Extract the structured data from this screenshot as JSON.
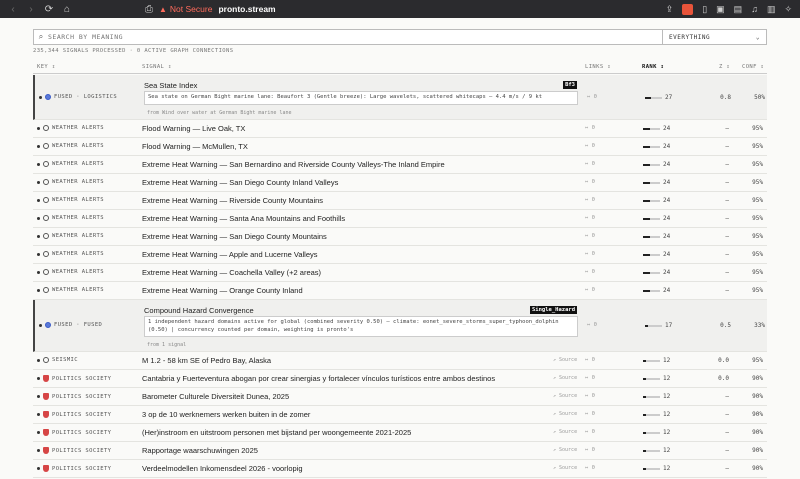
{
  "browser": {
    "security_label": "Not Secure",
    "host": "pronto.stream"
  },
  "search": {
    "placeholder": "SEARCH BY MEANING",
    "scope": "EVERYTHING"
  },
  "status_line": "235,344 SIGNALS PROCESSED · 0 ACTIVE GRAPH CONNECTIONS",
  "columns": {
    "key": "KEY ⇕",
    "signal": "SIGNAL ⇕",
    "links": "LINKS ⇕",
    "rank": "RANK ↕",
    "z": "Z ⇕",
    "conf": "CONF ⇕"
  },
  "rows": [
    {
      "key": "FUSED · LOGISTICS",
      "icon": "ring-blue",
      "title": "Sea State Index",
      "tag": "Bf3",
      "desc": "Sea state on German Bight marine lane: Beaufort 3 (Gentle breeze): Large wavelets, scattered whitecaps — 4.4 m/s / 9 kt",
      "from": "from Wind over water at German Bight marine lane",
      "links": "⇔ 0",
      "rank_fill": 0.35,
      "rank": "27",
      "z": "0.8",
      "conf": "50%",
      "source": ""
    },
    {
      "key": "WEATHER ALERTS",
      "icon": "ring",
      "title": "Flood Warning — Live Oak, TX",
      "links": "⇔ 0",
      "rank_fill": 0.4,
      "rank": "24",
      "z": "—",
      "conf": "95%",
      "source": ""
    },
    {
      "key": "WEATHER ALERTS",
      "icon": "ring",
      "title": "Flood Warning — McMullen, TX",
      "links": "⇔ 0",
      "rank_fill": 0.4,
      "rank": "24",
      "z": "—",
      "conf": "95%",
      "source": ""
    },
    {
      "key": "WEATHER ALERTS",
      "icon": "ring",
      "title": "Extreme Heat Warning — San Bernardino and Riverside County Valleys-The Inland Empire",
      "links": "⇔ 0",
      "rank_fill": 0.4,
      "rank": "24",
      "z": "—",
      "conf": "95%",
      "source": ""
    },
    {
      "key": "WEATHER ALERTS",
      "icon": "ring",
      "title": "Extreme Heat Warning — San Diego County Inland Valleys",
      "links": "⇔ 0",
      "rank_fill": 0.4,
      "rank": "24",
      "z": "—",
      "conf": "95%",
      "source": ""
    },
    {
      "key": "WEATHER ALERTS",
      "icon": "ring",
      "title": "Extreme Heat Warning — Riverside County Mountains",
      "links": "⇔ 0",
      "rank_fill": 0.4,
      "rank": "24",
      "z": "—",
      "conf": "95%",
      "source": ""
    },
    {
      "key": "WEATHER ALERTS",
      "icon": "ring",
      "title": "Extreme Heat Warning — Santa Ana Mountains and Foothills",
      "links": "⇔ 0",
      "rank_fill": 0.4,
      "rank": "24",
      "z": "—",
      "conf": "95%",
      "source": ""
    },
    {
      "key": "WEATHER ALERTS",
      "icon": "ring",
      "title": "Extreme Heat Warning — San Diego County Mountains",
      "links": "⇔ 0",
      "rank_fill": 0.4,
      "rank": "24",
      "z": "—",
      "conf": "95%",
      "source": ""
    },
    {
      "key": "WEATHER ALERTS",
      "icon": "ring",
      "title": "Extreme Heat Warning — Apple and Lucerne Valleys",
      "links": "⇔ 0",
      "rank_fill": 0.4,
      "rank": "24",
      "z": "—",
      "conf": "95%",
      "source": ""
    },
    {
      "key": "WEATHER ALERTS",
      "icon": "ring",
      "title": "Extreme Heat Warning — Coachella Valley (+2 areas)",
      "links": "⇔ 0",
      "rank_fill": 0.4,
      "rank": "24",
      "z": "—",
      "conf": "95%",
      "source": ""
    },
    {
      "key": "WEATHER ALERTS",
      "icon": "ring",
      "title": "Extreme Heat Warning — Orange County Inland",
      "links": "⇔ 0",
      "rank_fill": 0.4,
      "rank": "24",
      "z": "—",
      "conf": "95%",
      "source": ""
    },
    {
      "key": "FUSED · FUSED",
      "icon": "ring-blue",
      "title": "Compound Hazard Convergence",
      "tag": "Single_Hazard",
      "desc": "1 independent hazard domains active for global (combined severity 0.50) — climate: eonet_severe_storms_super_typhoon_dolphin (0.50) | concurrency counted per domain, weighting is pronto's",
      "from": "from 1 signal",
      "links": "⇔ 0",
      "rank_fill": 0.2,
      "rank": "17",
      "z": "0.5",
      "conf": "33%",
      "source": ""
    },
    {
      "key": "SEISMIC",
      "icon": "ring",
      "title": "M 1.2 - 58 km SE of Pedro Bay, Alaska",
      "links": "⇔ 0",
      "rank_fill": 0.15,
      "rank": "12",
      "z": "0.0",
      "conf": "95%",
      "source": "↗ Source"
    },
    {
      "key": "POLITICS SOCIETY",
      "icon": "shield",
      "title": "Cantabria y Fuerteventura abogan por crear sinergias y fortalecer vínculos turísticos entre ambos destinos",
      "links": "⇔ 0",
      "rank_fill": 0.15,
      "rank": "12",
      "z": "0.0",
      "conf": "90%",
      "source": "↗ Source"
    },
    {
      "key": "POLITICS SOCIETY",
      "icon": "shield",
      "title": "Barometer Culturele Diversiteit Dunea, 2025",
      "links": "⇔ 0",
      "rank_fill": 0.15,
      "rank": "12",
      "z": "—",
      "conf": "90%",
      "source": "↗ Source"
    },
    {
      "key": "POLITICS SOCIETY",
      "icon": "shield",
      "title": "3 op de 10 werknemers werken buiten in de zomer",
      "links": "⇔ 0",
      "rank_fill": 0.15,
      "rank": "12",
      "z": "—",
      "conf": "90%",
      "source": "↗ Source"
    },
    {
      "key": "POLITICS SOCIETY",
      "icon": "shield",
      "title": "(Her)instroom en uitstroom personen met bijstand per woongemeente 2021-2025",
      "links": "⇔ 0",
      "rank_fill": 0.15,
      "rank": "12",
      "z": "—",
      "conf": "90%",
      "source": "↗ Source"
    },
    {
      "key": "POLITICS SOCIETY",
      "icon": "shield",
      "title": "Rapportage waarschuwingen 2025",
      "links": "⇔ 0",
      "rank_fill": 0.15,
      "rank": "12",
      "z": "—",
      "conf": "90%",
      "source": "↗ Source"
    },
    {
      "key": "POLITICS SOCIETY",
      "icon": "shield",
      "title": "Verdeelmodellen Inkomensdeel 2026 - voorlopig",
      "links": "⇔ 0",
      "rank_fill": 0.15,
      "rank": "12",
      "z": "—",
      "conf": "90%",
      "source": "↗ Source"
    }
  ]
}
